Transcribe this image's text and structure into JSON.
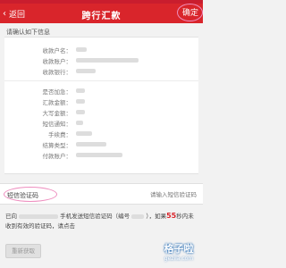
{
  "header": {
    "back_label": "返回",
    "back_icon": "chevron-left",
    "title": "跨行汇款",
    "confirm_label": "确定"
  },
  "prompt": "请确认如下信息",
  "transfer_info": {
    "rows": [
      {
        "label": "收款户名：",
        "value": ""
      },
      {
        "label": "收款账户：",
        "value": ""
      },
      {
        "label": "收款银行：",
        "value": ""
      },
      {
        "label": "是否加急：",
        "value": ""
      },
      {
        "label": "汇款金额：",
        "value": ""
      },
      {
        "label": "大写金额：",
        "value": ""
      },
      {
        "label": "短信通知：",
        "value": ""
      },
      {
        "label": "手续费：",
        "value": ""
      },
      {
        "label": "结算类型：",
        "value": ""
      },
      {
        "label": "付款账户：",
        "value": ""
      }
    ]
  },
  "sms": {
    "label": "短信验证码",
    "placeholder": "请输入短信验证码"
  },
  "notice": {
    "part1": "已向",
    "part2": "手机发送短信验证码（编号",
    "part3": "），如果",
    "seconds": "55",
    "part4": "秒内未收到有效的验证码，请点击"
  },
  "resend_label": "重新获取",
  "watermark": {
    "main": "格子啦",
    "sub": "gezila.com"
  },
  "colors": {
    "brand_red": "#d9252b",
    "highlight_ring": "#ee8ebf"
  }
}
